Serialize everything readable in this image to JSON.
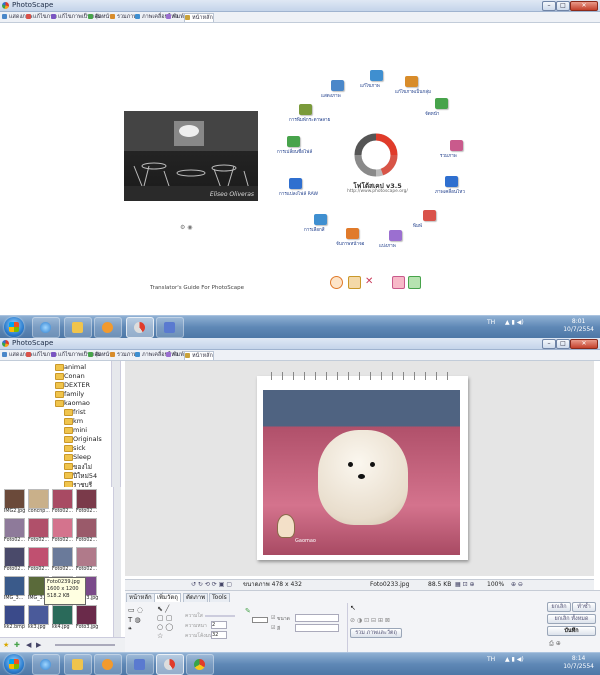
{
  "app": {
    "title": "PhotoScape"
  },
  "tabs": [
    "แสดงภาพ",
    "แก้ไขภาพ",
    "แก้ไขภาพเป็นกลุ่ม",
    "จัดหน้า",
    "รวมภาพ",
    "ภาพเคลื่อนไหว",
    "พิมพ์",
    "หน้าหลัก"
  ],
  "tab_colors": [
    "#4a87c9",
    "#d9524a",
    "#7a55c2",
    "#47a34b",
    "#d88c2a",
    "#3f8fd0",
    "#9b6fd0",
    "#c9a23a"
  ],
  "home": {
    "product": "โฟโต้สเคป v3.5",
    "url": "http://www.photoscape.org/",
    "photo_watermark": "Eliseo Oliveras",
    "guide": "Translator's Guide For PhotoScape",
    "menu": [
      {
        "label": "แสดงภาพ",
        "color": "#4a87c9"
      },
      {
        "label": "แก้ไขภาพ",
        "color": "#3f8fd0"
      },
      {
        "label": "แก้ไขภาพเป็นกลุ่ม",
        "color": "#d88c2a"
      },
      {
        "label": "จัดหน้า",
        "color": "#47a34b"
      },
      {
        "label": "รวมภาพ",
        "color": "#c95a8c"
      },
      {
        "label": "ภาพเคลื่อนไหว",
        "color": "#2f6fcf"
      },
      {
        "label": "พิมพ์",
        "color": "#d9524a"
      },
      {
        "label": "แบ่งภาพ",
        "color": "#9b6fd0"
      },
      {
        "label": "จับภาพหน้าจอ",
        "color": "#e07a2a"
      },
      {
        "label": "การเลือกสี",
        "color": "#3f8fd0"
      },
      {
        "label": "การแปลงไฟล์ RAW",
        "color": "#2f6fcf"
      },
      {
        "label": "การเปลี่ยนชื่อไฟล์",
        "color": "#47a34b"
      },
      {
        "label": "การพิมพ์กระดาษลาย",
        "color": "#7a9a3a"
      }
    ]
  },
  "taskbar_top": {
    "lang": "TH",
    "time": "8:01",
    "date": "10/7/2554"
  },
  "taskbar_bottom": {
    "lang": "TH",
    "time": "8:14",
    "date": "10/7/2554"
  },
  "editor": {
    "folders": [
      "animal",
      "Conan",
      "DEXTER",
      "family",
      "kaomao",
      "frist",
      "km",
      "mini",
      "Originals",
      "sick",
      "Sleep",
      "ของไม่",
      "ปีใหม่54",
      "ราชบุรี"
    ],
    "thumbs": [
      {
        "name": "IMG2.jpg",
        "color": "#6b4a3a"
      },
      {
        "name": "concnp...",
        "color": "#c9b08a"
      },
      {
        "name": "Foto02...",
        "color": "#a84a63"
      },
      {
        "name": "Foto02...",
        "color": "#7a3a4a"
      },
      {
        "name": "Foto02...",
        "color": "#8e7a9a"
      },
      {
        "name": "Foto02...",
        "color": "#b0506a"
      },
      {
        "name": "Foto02...",
        "color": "#d4738d"
      },
      {
        "name": "Foto02...",
        "color": "#9a5a6a"
      },
      {
        "name": "Foto02...",
        "color": "#4a4a6a"
      },
      {
        "name": "Foto02...",
        "color": "#c05070"
      },
      {
        "name": "Foto02...",
        "color": "#6a7a9a"
      },
      {
        "name": "Foto02...",
        "color": "#b07a8a"
      },
      {
        "name": "IMG_3...",
        "color": "#3a5a8a"
      },
      {
        "name": "IMG_3...",
        "color": "#5a6a3a"
      },
      {
        "name": "IMG_3...",
        "color": "#8a6a4a"
      },
      {
        "name": "Foto3.jpg",
        "color": "#7a4a8a"
      },
      {
        "name": "kk2.bmp",
        "color": "#3a4a8a"
      },
      {
        "name": "kk3.jpg",
        "color": "#4a5a9a"
      },
      {
        "name": "kk4.jpg",
        "color": "#2a6a5a"
      },
      {
        "name": "Foto3.jpg",
        "color": "#6a2a4a"
      }
    ],
    "tooltip": {
      "name": "Foto0239.jpg",
      "dims": "1600 x 1200",
      "size": "518.2 KB"
    },
    "info": {
      "size_label": "ขนาดภาพ 478 x 432",
      "file": "Foto0233.jpg",
      "kb": "88.5 KB",
      "zoom": "100%"
    },
    "sticker_text": "Gaomao",
    "panel_tabs": [
      "หน้าหลัก",
      "เพิ่มวัตถุ",
      "ตัดภาพ",
      "Tools"
    ],
    "panel_labels": {
      "transparency": "ความใส",
      "thickness": "ความหนา",
      "roundness": "ความโค้งมน",
      "border": "ขนาด",
      "color": "สี"
    },
    "panel_values": {
      "thickness": "2",
      "roundness": "32"
    },
    "merge_button": "รวม ภาพและวัตถุ",
    "right_buttons": {
      "undo": "ยกเลิก",
      "redo": "ทำซ้ำ",
      "undo_all": "ยกเลิก ทั้งหมด",
      "save": "บันทึก"
    }
  }
}
